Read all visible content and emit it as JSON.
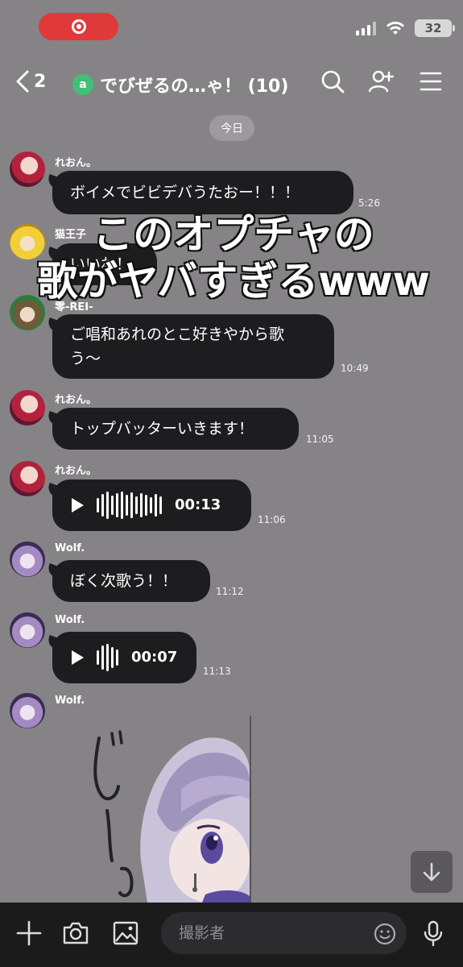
{
  "status_bar": {
    "battery": "32"
  },
  "header": {
    "back_count": "2",
    "group_icon_letter": "a",
    "title": "でびぜるの…ゃ！ (10)"
  },
  "date_chip": "今日",
  "messages": [
    {
      "sender": "れおん。",
      "text": "ボイメでビビデバうたおー！！！",
      "time": "5:26"
    },
    {
      "sender": "猫王子",
      "text": "いいね！",
      "time": ""
    },
    {
      "sender": "零-REI-",
      "text": "ご唱和あれのとこ好きやから歌う〜",
      "line1": "ご唱和あれのとこ好きやから歌",
      "line2": "う〜",
      "time": "10:49"
    },
    {
      "sender": "れおん。",
      "text": "トップバッターいきます！",
      "time": "11:05"
    },
    {
      "sender": "れおん。",
      "voice_duration": "00:13",
      "time": "11:06"
    },
    {
      "sender": "Wolf.",
      "text": "ぼく次歌う！！",
      "time": "11:12"
    },
    {
      "sender": "Wolf.",
      "voice_duration": "00:07",
      "time": "11:13"
    },
    {
      "sender": "Wolf.",
      "sticker_text": "じーっ"
    }
  ],
  "overlay_caption": {
    "line1": "このオプチャの",
    "line2": "歌がヤバすぎるwww"
  },
  "input": {
    "placeholder": "撮影者"
  },
  "icons": {
    "header": [
      "back-chevron-icon",
      "search-icon",
      "add-friend-icon",
      "menu-icon"
    ],
    "bottom": [
      "plus-icon",
      "camera-icon",
      "image-icon",
      "emoji-icon",
      "microphone-icon"
    ]
  },
  "colors": {
    "background": "#858386",
    "bubble": "#1d1d1f",
    "record": "#e0393a",
    "group_badge": "#3fc078"
  }
}
